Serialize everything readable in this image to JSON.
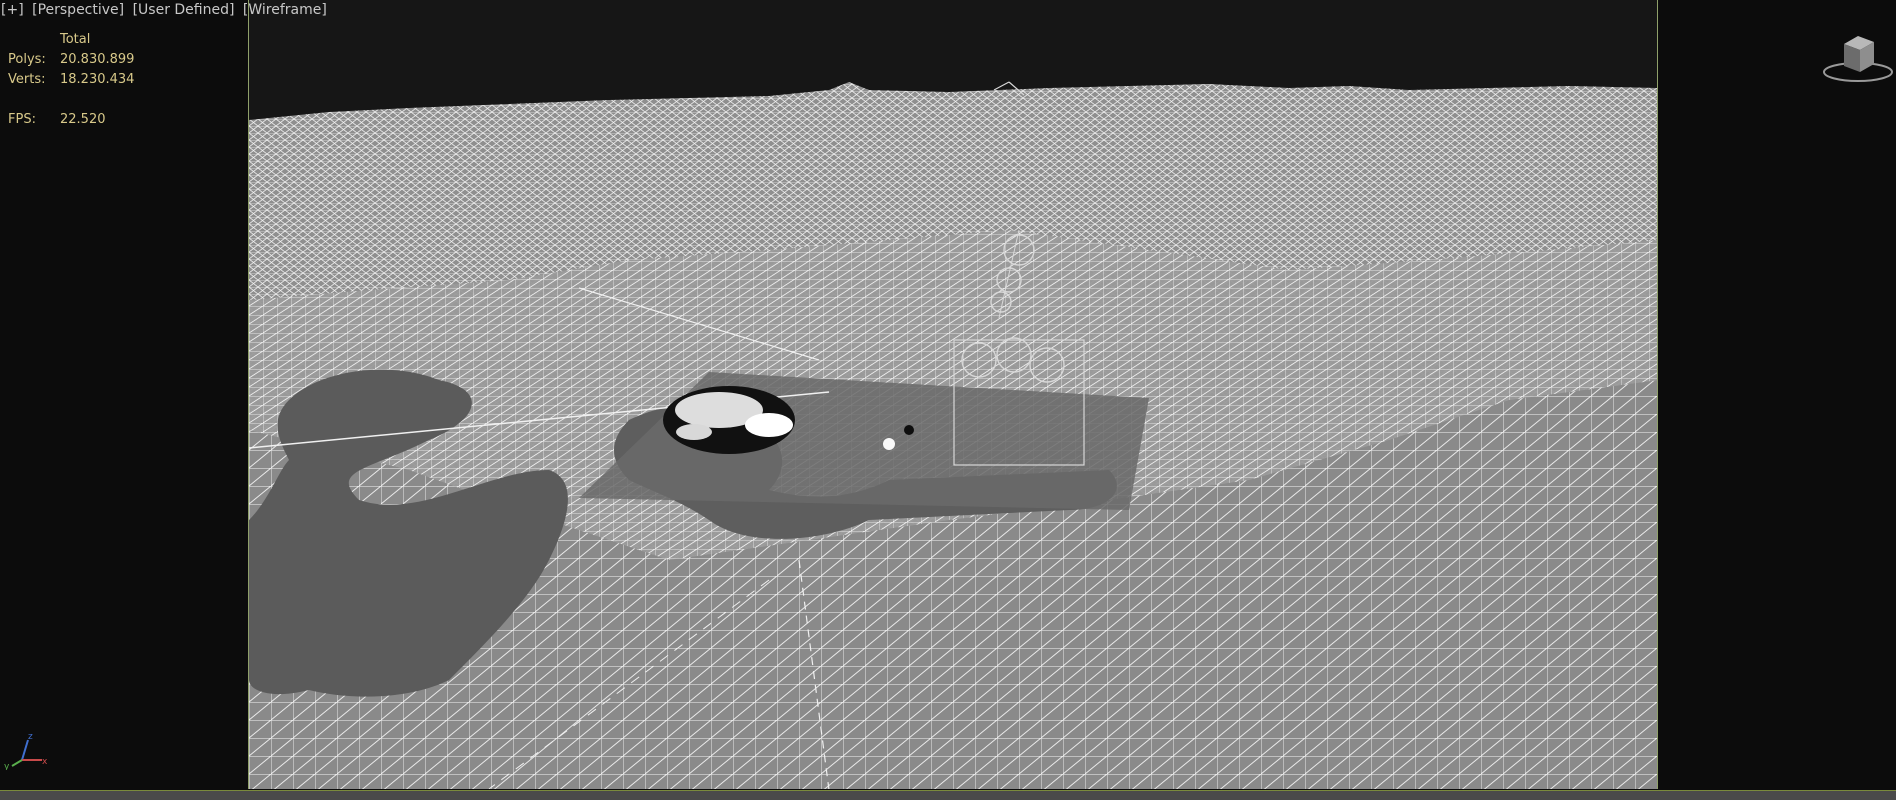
{
  "viewport": {
    "labels": [
      "[+]",
      "[Perspective]",
      "[User Defined]",
      "[Wireframe]"
    ],
    "render_mode": "Wireframe"
  },
  "stats": {
    "header": "Total",
    "polys_label": "Polys:",
    "polys_value": "20.830.899",
    "verts_label": "Verts:",
    "verts_value": "18.230.434",
    "fps_label": "FPS:",
    "fps_value": "22.520"
  },
  "axis": {
    "x": "x",
    "y": "y",
    "z": "z"
  },
  "colors": {
    "background": "#0c0c0c",
    "stats_text": "#d8c98a",
    "label_text": "#c8c8c8",
    "safe_frame": "#8fa06a",
    "wire": "#e6e6e6",
    "mesh_shadow": "#5a5a5a"
  },
  "icons": {
    "viewcube": "viewcube-icon",
    "axis": "axis-tripod-icon"
  }
}
